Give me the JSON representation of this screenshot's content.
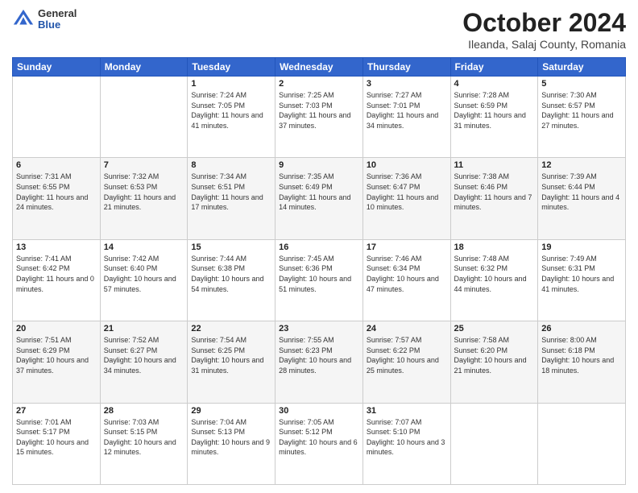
{
  "header": {
    "logo": {
      "general": "General",
      "blue": "Blue"
    },
    "title": "October 2024",
    "location": "Ileanda, Salaj County, Romania"
  },
  "weekdays": [
    "Sunday",
    "Monday",
    "Tuesday",
    "Wednesday",
    "Thursday",
    "Friday",
    "Saturday"
  ],
  "weeks": [
    [
      {
        "day": "",
        "info": ""
      },
      {
        "day": "",
        "info": ""
      },
      {
        "day": "1",
        "info": "Sunrise: 7:24 AM\nSunset: 7:05 PM\nDaylight: 11 hours and 41 minutes."
      },
      {
        "day": "2",
        "info": "Sunrise: 7:25 AM\nSunset: 7:03 PM\nDaylight: 11 hours and 37 minutes."
      },
      {
        "day": "3",
        "info": "Sunrise: 7:27 AM\nSunset: 7:01 PM\nDaylight: 11 hours and 34 minutes."
      },
      {
        "day": "4",
        "info": "Sunrise: 7:28 AM\nSunset: 6:59 PM\nDaylight: 11 hours and 31 minutes."
      },
      {
        "day": "5",
        "info": "Sunrise: 7:30 AM\nSunset: 6:57 PM\nDaylight: 11 hours and 27 minutes."
      }
    ],
    [
      {
        "day": "6",
        "info": "Sunrise: 7:31 AM\nSunset: 6:55 PM\nDaylight: 11 hours and 24 minutes."
      },
      {
        "day": "7",
        "info": "Sunrise: 7:32 AM\nSunset: 6:53 PM\nDaylight: 11 hours and 21 minutes."
      },
      {
        "day": "8",
        "info": "Sunrise: 7:34 AM\nSunset: 6:51 PM\nDaylight: 11 hours and 17 minutes."
      },
      {
        "day": "9",
        "info": "Sunrise: 7:35 AM\nSunset: 6:49 PM\nDaylight: 11 hours and 14 minutes."
      },
      {
        "day": "10",
        "info": "Sunrise: 7:36 AM\nSunset: 6:47 PM\nDaylight: 11 hours and 10 minutes."
      },
      {
        "day": "11",
        "info": "Sunrise: 7:38 AM\nSunset: 6:46 PM\nDaylight: 11 hours and 7 minutes."
      },
      {
        "day": "12",
        "info": "Sunrise: 7:39 AM\nSunset: 6:44 PM\nDaylight: 11 hours and 4 minutes."
      }
    ],
    [
      {
        "day": "13",
        "info": "Sunrise: 7:41 AM\nSunset: 6:42 PM\nDaylight: 11 hours and 0 minutes."
      },
      {
        "day": "14",
        "info": "Sunrise: 7:42 AM\nSunset: 6:40 PM\nDaylight: 10 hours and 57 minutes."
      },
      {
        "day": "15",
        "info": "Sunrise: 7:44 AM\nSunset: 6:38 PM\nDaylight: 10 hours and 54 minutes."
      },
      {
        "day": "16",
        "info": "Sunrise: 7:45 AM\nSunset: 6:36 PM\nDaylight: 10 hours and 51 minutes."
      },
      {
        "day": "17",
        "info": "Sunrise: 7:46 AM\nSunset: 6:34 PM\nDaylight: 10 hours and 47 minutes."
      },
      {
        "day": "18",
        "info": "Sunrise: 7:48 AM\nSunset: 6:32 PM\nDaylight: 10 hours and 44 minutes."
      },
      {
        "day": "19",
        "info": "Sunrise: 7:49 AM\nSunset: 6:31 PM\nDaylight: 10 hours and 41 minutes."
      }
    ],
    [
      {
        "day": "20",
        "info": "Sunrise: 7:51 AM\nSunset: 6:29 PM\nDaylight: 10 hours and 37 minutes."
      },
      {
        "day": "21",
        "info": "Sunrise: 7:52 AM\nSunset: 6:27 PM\nDaylight: 10 hours and 34 minutes."
      },
      {
        "day": "22",
        "info": "Sunrise: 7:54 AM\nSunset: 6:25 PM\nDaylight: 10 hours and 31 minutes."
      },
      {
        "day": "23",
        "info": "Sunrise: 7:55 AM\nSunset: 6:23 PM\nDaylight: 10 hours and 28 minutes."
      },
      {
        "day": "24",
        "info": "Sunrise: 7:57 AM\nSunset: 6:22 PM\nDaylight: 10 hours and 25 minutes."
      },
      {
        "day": "25",
        "info": "Sunrise: 7:58 AM\nSunset: 6:20 PM\nDaylight: 10 hours and 21 minutes."
      },
      {
        "day": "26",
        "info": "Sunrise: 8:00 AM\nSunset: 6:18 PM\nDaylight: 10 hours and 18 minutes."
      }
    ],
    [
      {
        "day": "27",
        "info": "Sunrise: 7:01 AM\nSunset: 5:17 PM\nDaylight: 10 hours and 15 minutes."
      },
      {
        "day": "28",
        "info": "Sunrise: 7:03 AM\nSunset: 5:15 PM\nDaylight: 10 hours and 12 minutes."
      },
      {
        "day": "29",
        "info": "Sunrise: 7:04 AM\nSunset: 5:13 PM\nDaylight: 10 hours and 9 minutes."
      },
      {
        "day": "30",
        "info": "Sunrise: 7:05 AM\nSunset: 5:12 PM\nDaylight: 10 hours and 6 minutes."
      },
      {
        "day": "31",
        "info": "Sunrise: 7:07 AM\nSunset: 5:10 PM\nDaylight: 10 hours and 3 minutes."
      },
      {
        "day": "",
        "info": ""
      },
      {
        "day": "",
        "info": ""
      }
    ]
  ]
}
